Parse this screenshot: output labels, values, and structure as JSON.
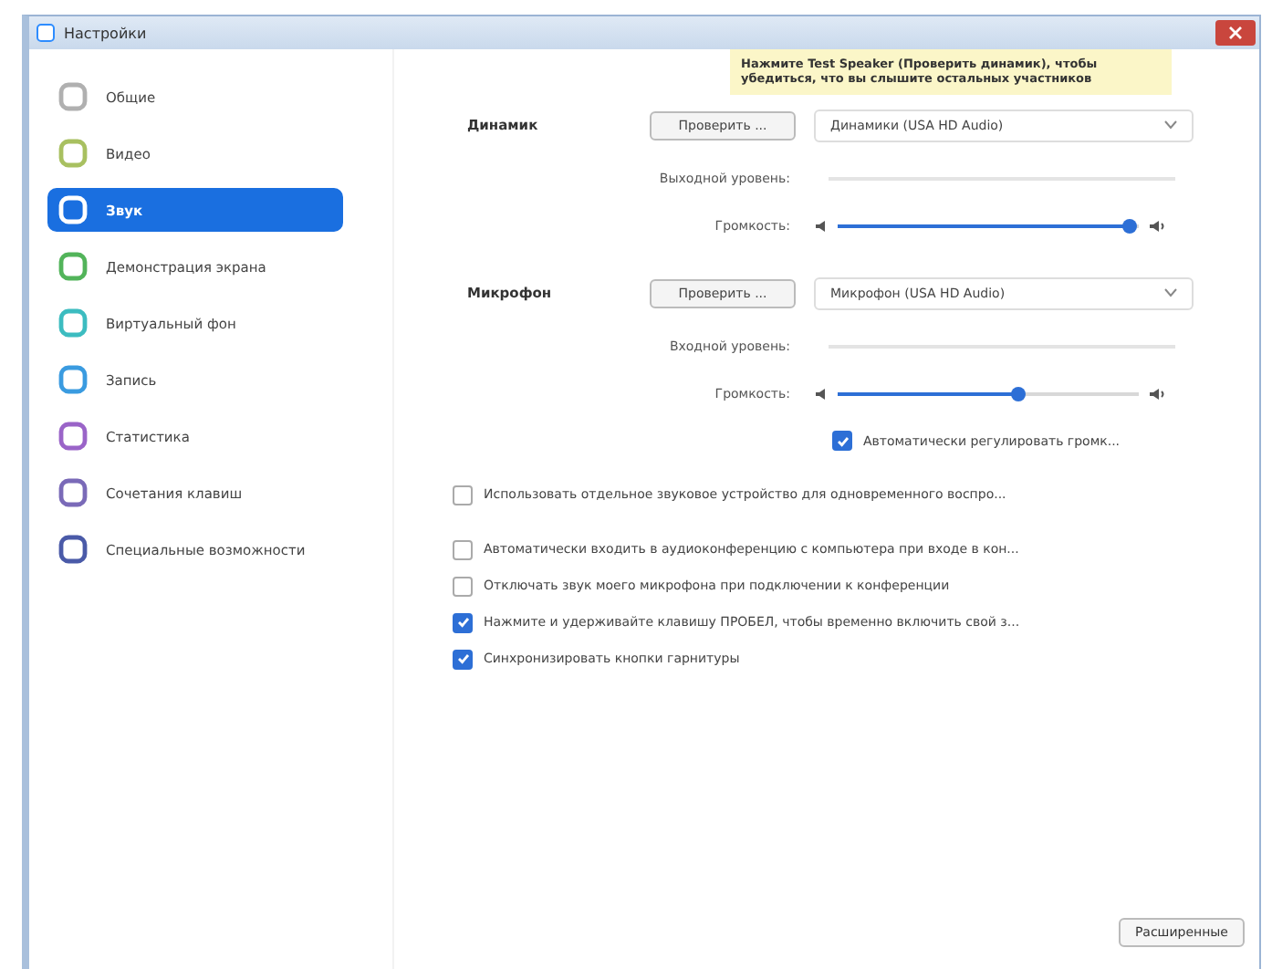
{
  "window": {
    "title": "Настройки"
  },
  "sidebar": {
    "items": [
      {
        "label": "Общие",
        "selected": false,
        "color": "#b0b0b0"
      },
      {
        "label": "Видео",
        "selected": false,
        "color": "#a8c060"
      },
      {
        "label": "Звук",
        "selected": true,
        "color": "#ffffff"
      },
      {
        "label": "Демонстрация экрана",
        "selected": false,
        "color": "#52b45a"
      },
      {
        "label": "Виртуальный фон",
        "selected": false,
        "color": "#3cbcc0"
      },
      {
        "label": "Запись",
        "selected": false,
        "color": "#3a9be0"
      },
      {
        "label": "Статистика",
        "selected": false,
        "color": "#9a64c8"
      },
      {
        "label": "Сочетания клавиш",
        "selected": false,
        "color": "#7a6ab8"
      },
      {
        "label": "Специальные возможности",
        "selected": false,
        "color": "#4a5aa8"
      }
    ]
  },
  "tooltip": "Нажмите Test Speaker (Проверить динамик), чтобы убедиться, что вы слышите остальных участников",
  "speaker": {
    "label": "Динамик",
    "test_button": "Проверить ...",
    "device": "Динамики (USA HD Audio)",
    "level_label": "Выходной уровень:",
    "volume_label": "Громкость:",
    "volume": {
      "level": 0.97
    }
  },
  "microphone": {
    "label": "Микрофон",
    "test_button": "Проверить ...",
    "device": "Микрофон (USA HD Audio)",
    "level_label": "Входной уровень:",
    "volume_label": "Громкость:",
    "volume": {
      "level": 0.6
    },
    "auto_adjust": {
      "label": "Автоматически регулировать громк...",
      "checked": true
    }
  },
  "options": [
    {
      "label": "Использовать отдельное звуковое устройство для одновременного воспро...",
      "checked": false
    },
    {
      "label": "Автоматически входить в аудиоконференцию с компьютера при входе в кон...",
      "checked": false
    },
    {
      "label": "Отключать звук моего микрофона при подключении к конференции",
      "checked": false
    },
    {
      "label": "Нажмите и удерживайте клавишу ПРОБЕЛ, чтобы временно включить свой з...",
      "checked": true
    },
    {
      "label": "Синхронизировать кнопки гарнитуры",
      "checked": true
    }
  ],
  "advanced_button": "Расширенные"
}
